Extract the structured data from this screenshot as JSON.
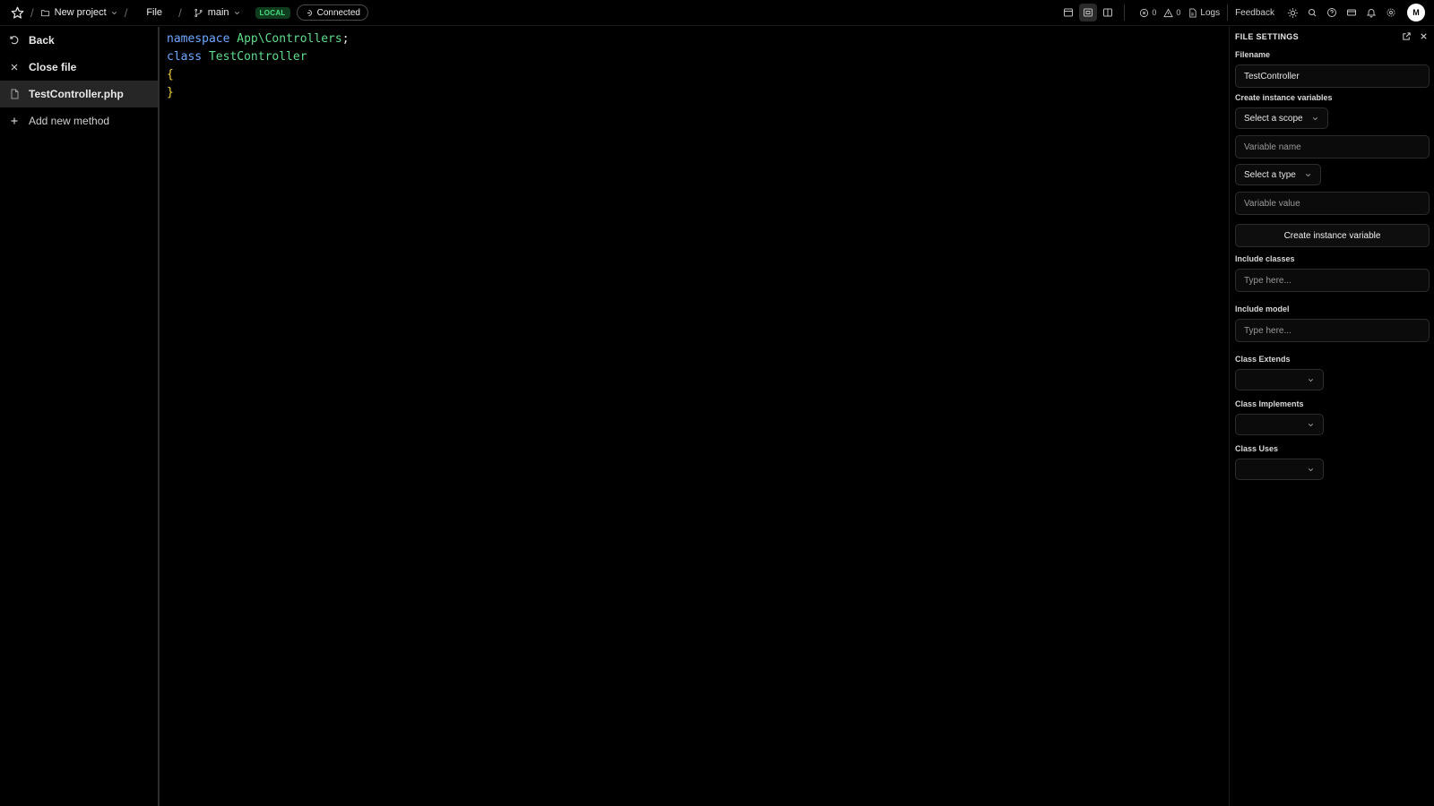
{
  "topbar": {
    "project": "New project",
    "file": "File",
    "branch": "main",
    "env_badge": "LOCAL",
    "connection_status": "Connected",
    "errors_count": "0",
    "warnings_count": "0",
    "logs_label": "Logs",
    "feedback_label": "Feedback",
    "avatar_initial": "M"
  },
  "sidebar": {
    "back_label": "Back",
    "close_file_label": "Close file",
    "active_file": "TestController.php",
    "add_method_label": "Add new method"
  },
  "editor": {
    "line1_kw": "namespace",
    "line1_ns": "App\\Controllers",
    "line1_end": ";",
    "line2_kw": "class",
    "line2_cls": "TestController",
    "line3": "{",
    "line4": "}"
  },
  "panel": {
    "title": "FILE SETTINGS",
    "filename_label": "Filename",
    "filename_value": "TestController",
    "instance_vars_label": "Create instance variables",
    "scope_placeholder": "Select a scope",
    "var_name_placeholder": "Variable name",
    "type_placeholder": "Select a type",
    "var_value_placeholder": "Variable value",
    "create_var_button": "Create instance variable",
    "include_classes_label": "Include classes",
    "include_classes_placeholder": "Type here...",
    "include_model_label": "Include model",
    "include_model_placeholder": "Type here...",
    "class_extends_label": "Class Extends",
    "class_implements_label": "Class Implements",
    "class_uses_label": "Class Uses"
  },
  "colors": {
    "keyword": "#6ea8ff",
    "identifier": "#5fdc8c",
    "brace": "#f2d03b",
    "local_badge_bg": "#0f3d1e",
    "local_badge_text": "#4ade80"
  }
}
